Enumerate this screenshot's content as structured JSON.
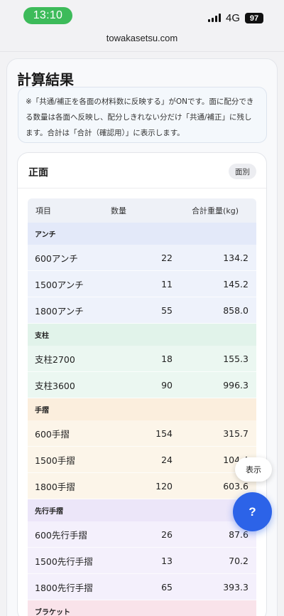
{
  "status_bar": {
    "time": "13:10",
    "network": "4G",
    "battery": "97"
  },
  "browser": {
    "url": "towakasetsu.com"
  },
  "page": {
    "title": "計算結果",
    "notice": "※「共通/補正を各面の材料数に反映する」がONです。面に配分できる数量は各面へ反映し、配分しきれない分だけ「共通/補正」に残します。合計は「合計（確認用）」に表示します。"
  },
  "section": {
    "title": "正面",
    "badge": "面別",
    "table": {
      "headers": {
        "name": "項目",
        "qty": "数量",
        "weight": "合計重量(kg)"
      },
      "groups": [
        {
          "label": "アンチ",
          "rows": [
            {
              "name": "600アンチ",
              "qty": "22",
              "weight": "134.2"
            },
            {
              "name": "1500アンチ",
              "qty": "11",
              "weight": "145.2"
            },
            {
              "name": "1800アンチ",
              "qty": "55",
              "weight": "858.0"
            }
          ]
        },
        {
          "label": "支柱",
          "rows": [
            {
              "name": "支柱2700",
              "qty": "18",
              "weight": "155.3"
            },
            {
              "name": "支柱3600",
              "qty": "90",
              "weight": "996.3"
            }
          ]
        },
        {
          "label": "手摺",
          "rows": [
            {
              "name": "600手摺",
              "qty": "154",
              "weight": "315.7"
            },
            {
              "name": "1500手摺",
              "qty": "24",
              "weight": "104.4"
            },
            {
              "name": "1800手摺",
              "qty": "120",
              "weight": "603.6"
            }
          ]
        },
        {
          "label": "先行手摺",
          "rows": [
            {
              "name": "600先行手摺",
              "qty": "26",
              "weight": "87.6"
            },
            {
              "name": "1500先行手摺",
              "qty": "13",
              "weight": "70.2"
            },
            {
              "name": "1800先行手摺",
              "qty": "65",
              "weight": "393.3"
            }
          ]
        },
        {
          "label": "ブラケット",
          "rows": []
        }
      ]
    }
  },
  "floating": {
    "show_label": "表示",
    "help_label": "?"
  },
  "colors": {
    "accent": "#2c63e8",
    "time_pill": "#3dbb5a"
  }
}
